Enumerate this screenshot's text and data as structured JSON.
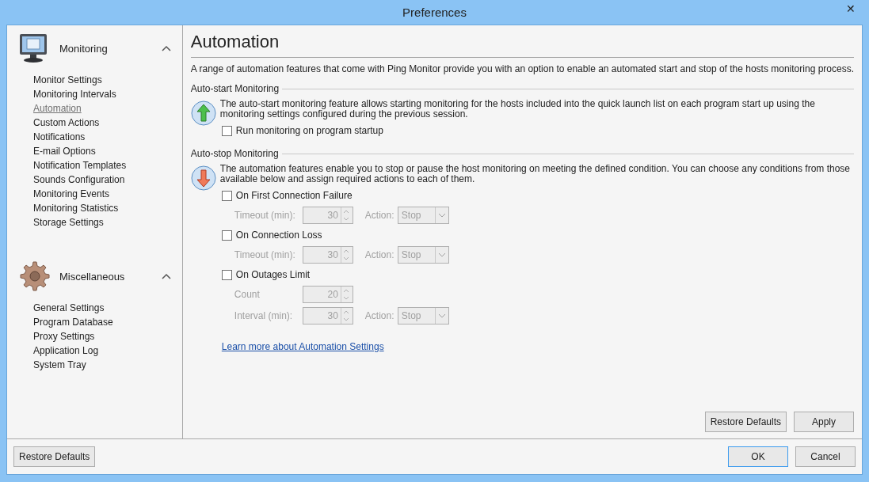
{
  "window": {
    "title": "Preferences",
    "close": "✕"
  },
  "sidebar": {
    "groups": [
      {
        "title": "Monitoring",
        "kind": "monitor",
        "expanded": true,
        "items": [
          {
            "label": "Monitor Settings",
            "selected": false
          },
          {
            "label": "Monitoring Intervals",
            "selected": false
          },
          {
            "label": "Automation",
            "selected": true
          },
          {
            "label": "Custom Actions",
            "selected": false
          },
          {
            "label": "Notifications",
            "selected": false
          },
          {
            "label": "E-mail Options",
            "selected": false
          },
          {
            "label": "Notification Templates",
            "selected": false
          },
          {
            "label": "Sounds Configuration",
            "selected": false
          },
          {
            "label": "Monitoring Events",
            "selected": false
          },
          {
            "label": "Monitoring Statistics",
            "selected": false
          },
          {
            "label": "Storage Settings",
            "selected": false
          }
        ]
      },
      {
        "title": "Miscellaneous",
        "kind": "gear",
        "expanded": true,
        "items": [
          {
            "label": "General Settings",
            "selected": false
          },
          {
            "label": "Program Database",
            "selected": false
          },
          {
            "label": "Proxy Settings",
            "selected": false
          },
          {
            "label": "Application Log",
            "selected": false
          },
          {
            "label": "System Tray",
            "selected": false
          }
        ]
      }
    ]
  },
  "content": {
    "heading": "Automation",
    "intro": "A range of automation features that come with Ping Monitor provide you with an option to enable an automated start and stop of the hosts monitoring process.",
    "sections": [
      {
        "title": "Auto-start Monitoring",
        "kind": "start",
        "description": "The auto-start monitoring feature allows starting monitoring for the hosts included into the quick launch list on each program start up using the monitoring settings configured during the previous session.",
        "options": [
          {
            "label": "Run monitoring on program startup",
            "checked": false
          }
        ]
      },
      {
        "title": "Auto-stop Monitoring",
        "kind": "stop",
        "description": "The automation features enable you to stop or pause the host monitoring on meeting the defined condition. You can choose any conditions from those available below and assign required actions to each of them.",
        "options": [
          {
            "label": "On First Connection Failure",
            "checked": false,
            "fields": [
              {
                "label": "Timeout (min):",
                "value": "30",
                "action_label": "Action:",
                "action": "Stop",
                "disabled": true
              }
            ]
          },
          {
            "label": "On Connection Loss",
            "checked": false,
            "fields": [
              {
                "label": "Timeout (min):",
                "value": "30",
                "action_label": "Action:",
                "action": "Stop",
                "disabled": true
              }
            ]
          },
          {
            "label": "On Outages Limit",
            "checked": false,
            "fields": [
              {
                "label": "Count",
                "value": "20",
                "disabled": true
              },
              {
                "label": "Interval (min):",
                "value": "30",
                "action_label": "Action:",
                "action": "Stop",
                "disabled": true
              }
            ]
          }
        ]
      }
    ],
    "link": "Learn more about Automation Settings",
    "buttons": [
      "Restore Defaults",
      "Apply"
    ]
  },
  "footer": {
    "left_button": "Restore Defaults",
    "buttons": [
      "OK",
      "Cancel"
    ]
  }
}
